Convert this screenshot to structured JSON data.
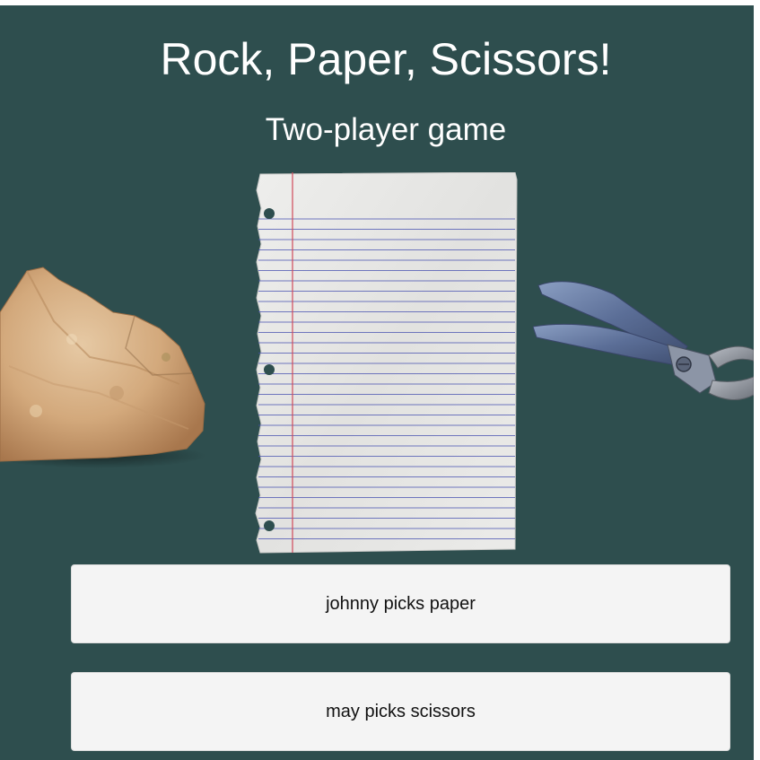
{
  "header": {
    "title": "Rock, Paper, Scissors!",
    "subtitle": "Two-player game"
  },
  "choices": [
    {
      "name": "rock",
      "icon": "rock-image"
    },
    {
      "name": "paper",
      "icon": "paper-image"
    },
    {
      "name": "scissors",
      "icon": "scissors-image"
    }
  ],
  "results": [
    {
      "text": "johnny picks paper"
    },
    {
      "text": "may picks scissors"
    }
  ],
  "colors": {
    "background": "#2e4e4e",
    "title_text": "#ffffff",
    "result_box": "#f4f4f4",
    "result_text": "#111111"
  }
}
